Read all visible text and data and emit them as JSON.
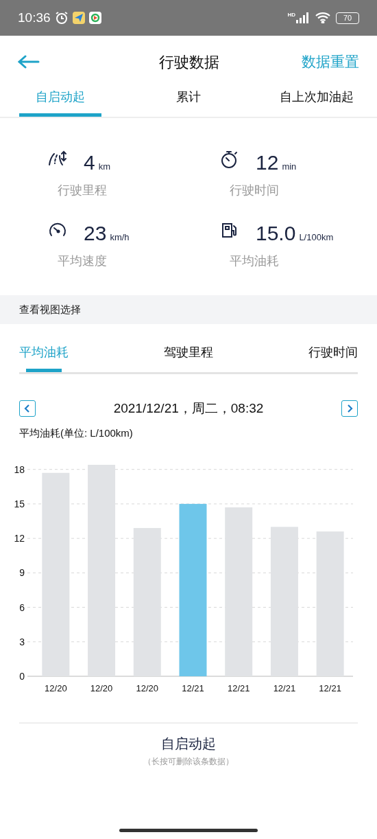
{
  "status_bar": {
    "time": "10:36",
    "network": "HD",
    "battery": "70"
  },
  "header": {
    "title": "行驶数据",
    "action": "数据重置"
  },
  "tabs": [
    {
      "label": "自启动起",
      "selected": true
    },
    {
      "label": "累计",
      "selected": false
    },
    {
      "label": "自上次加油起",
      "selected": false
    }
  ],
  "stats": [
    {
      "kind": "distance",
      "value": "4",
      "unit": "km",
      "label": "行驶里程"
    },
    {
      "kind": "time",
      "value": "12",
      "unit": "min",
      "label": "行驶时间"
    },
    {
      "kind": "speed",
      "value": "23",
      "unit": "km/h",
      "label": "平均速度"
    },
    {
      "kind": "fuel",
      "value": "15.0",
      "unit": "L/100km",
      "label": "平均油耗"
    }
  ],
  "section_title": "查看视图选择",
  "view_tabs": [
    {
      "label": "平均油耗",
      "selected": true
    },
    {
      "label": "驾驶里程",
      "selected": false
    },
    {
      "label": "行驶时间",
      "selected": false
    }
  ],
  "date": "2021/12/21，周二，08:32",
  "chart_label": "平均油耗(单位: L/100km)",
  "chart_data": {
    "type": "bar",
    "grid": true,
    "categories": [
      "12/20",
      "12/20",
      "12/20",
      "12/21",
      "12/21",
      "12/21",
      "12/21"
    ],
    "ylim": [
      0,
      18.4
    ],
    "yticks": [
      0,
      3,
      6,
      9,
      12,
      15,
      18
    ],
    "values": [
      17.7,
      18.4,
      12.9,
      15.0,
      14.7,
      13.0,
      12.6
    ]
  },
  "chart_bars": [
    {
      "selected": false
    },
    {
      "selected": false
    },
    {
      "selected": false
    },
    {
      "selected": true
    },
    {
      "selected": false
    },
    {
      "selected": false
    },
    {
      "selected": false
    }
  ],
  "footer": {
    "title": "自启动起",
    "hint": "（长按可删除该条数据）"
  }
}
